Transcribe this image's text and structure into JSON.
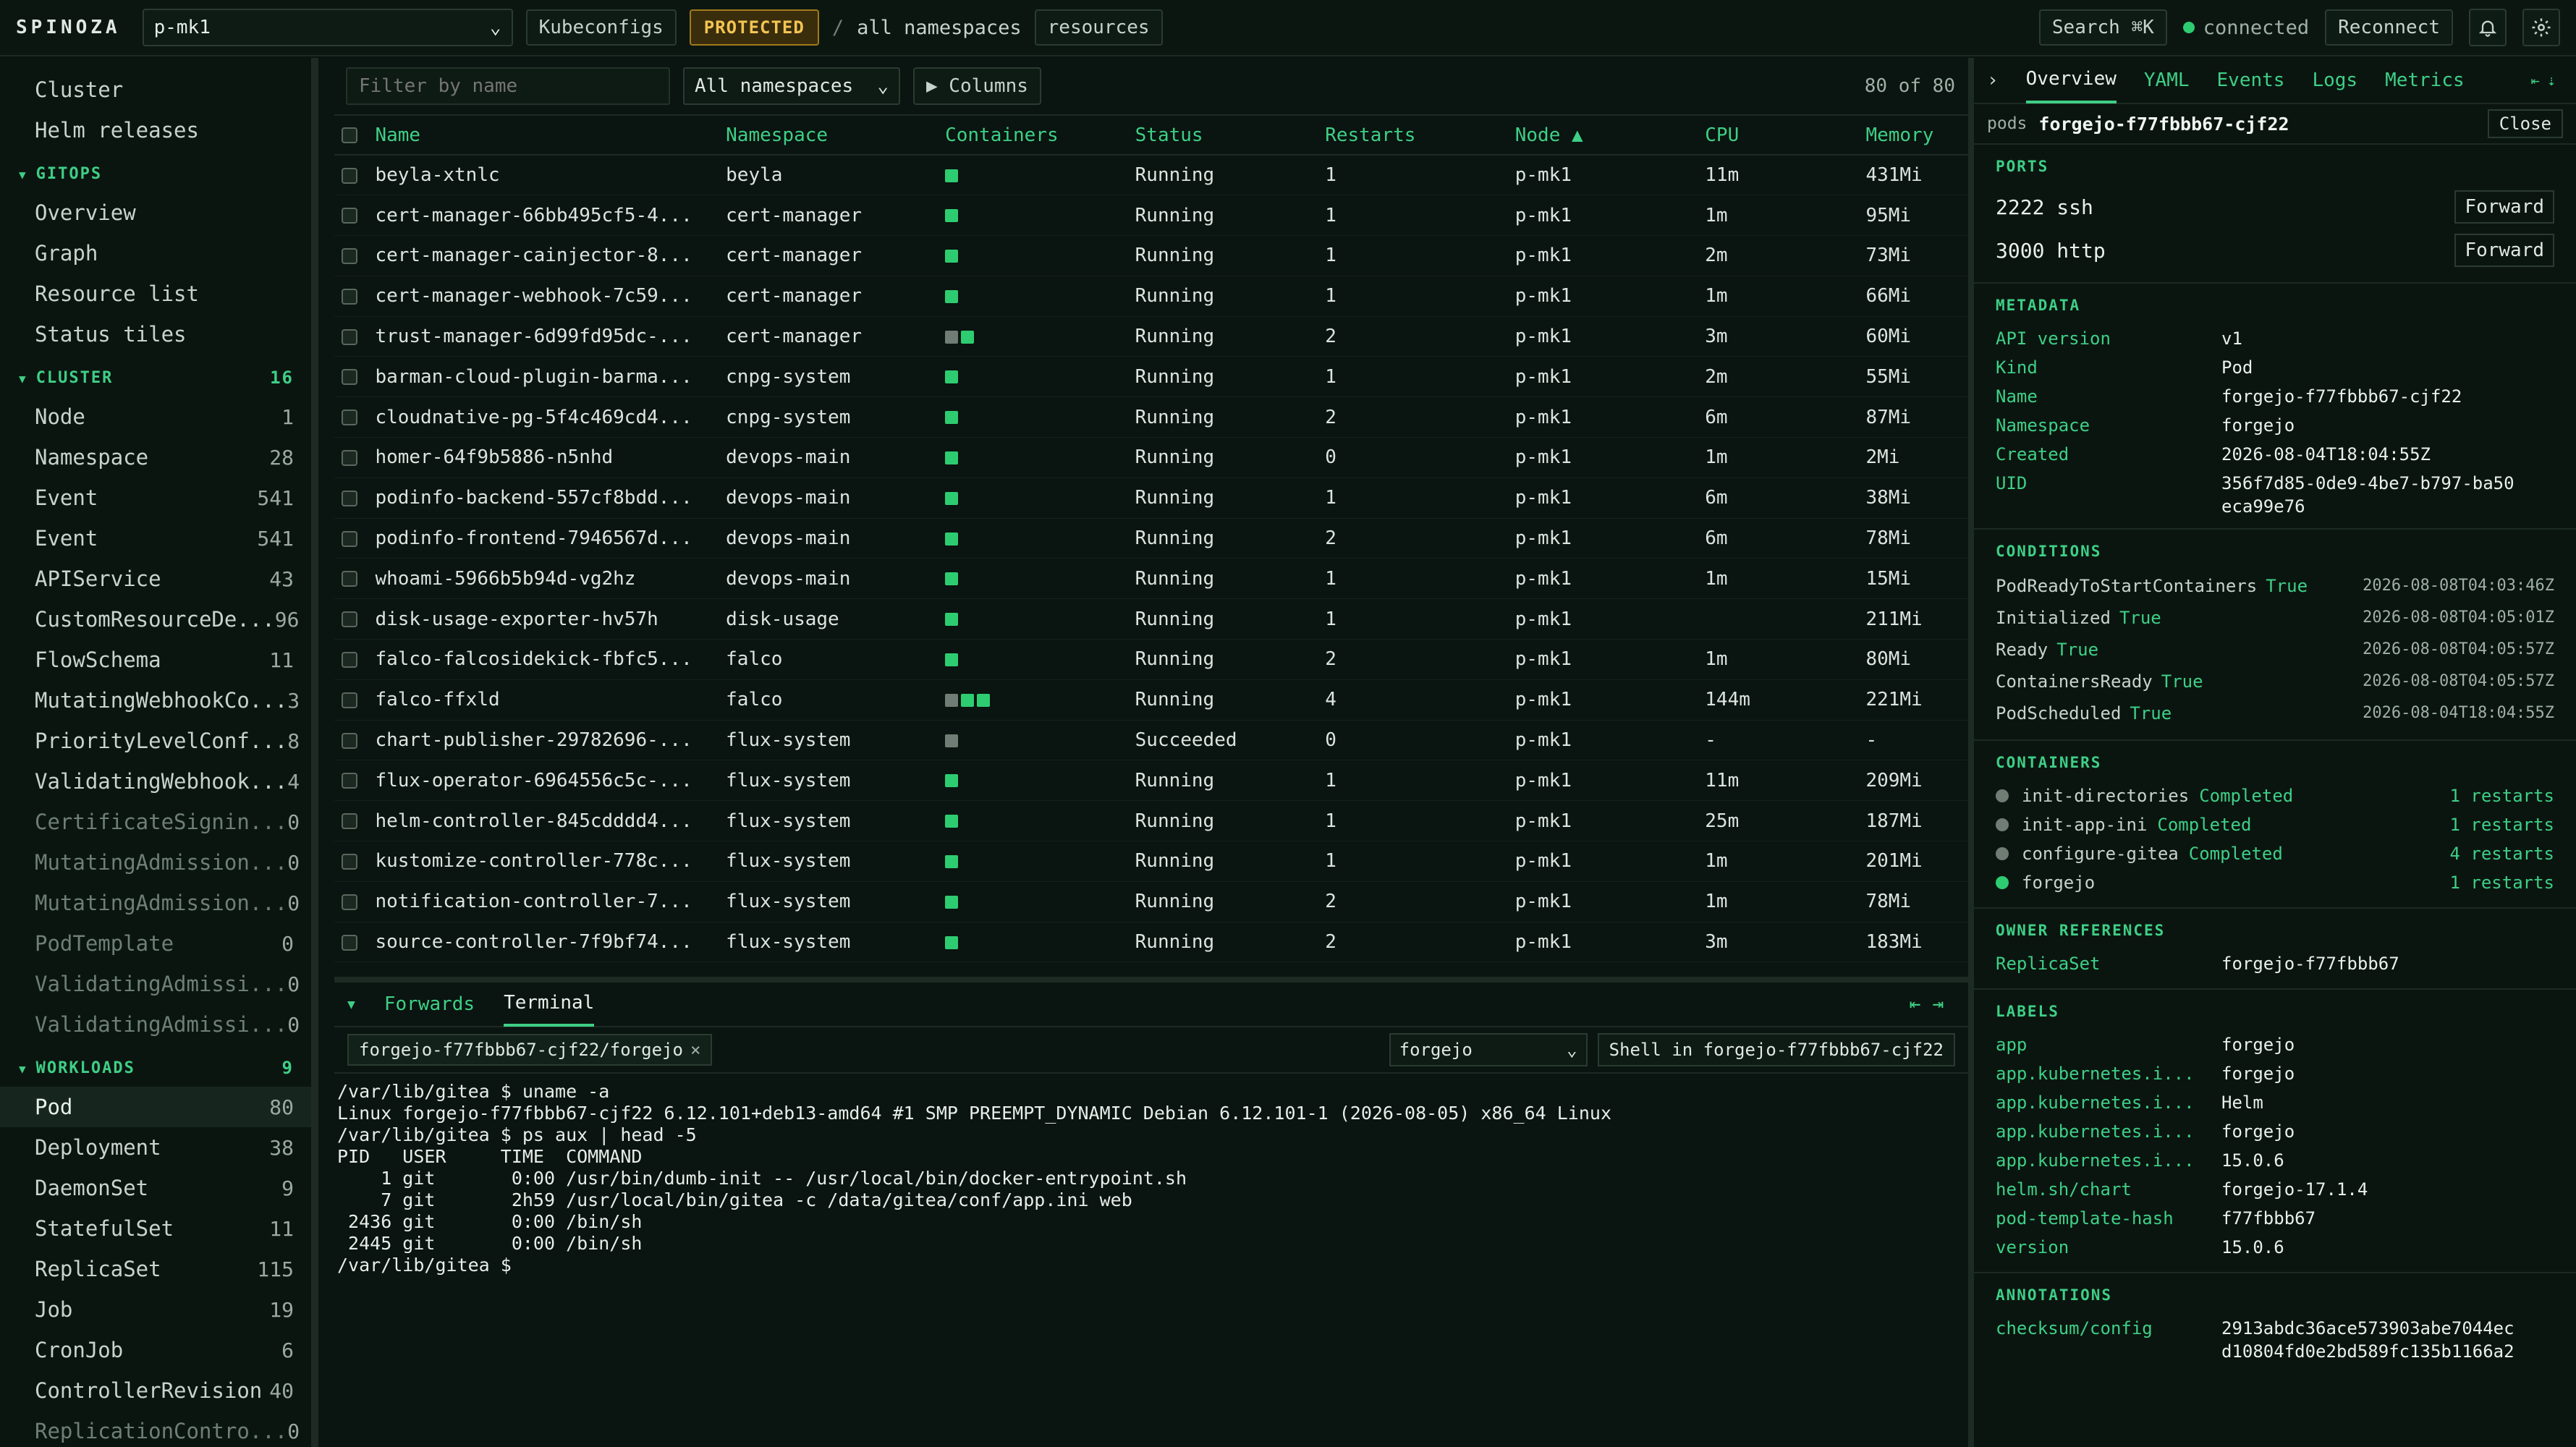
{
  "topbar": {
    "brand": "SPINOZA",
    "context": "p-mk1",
    "kubeconfigs": "Kubeconfigs",
    "protected": "PROTECTED",
    "sep": "/",
    "namespace_crumb": "all namespaces",
    "resources": "resources",
    "search": "Search ⌘K",
    "status": "connected",
    "reconnect": "Reconnect"
  },
  "sidebar": {
    "top_items": [
      {
        "label": "Cluster"
      },
      {
        "label": "Helm releases"
      }
    ],
    "gitops": {
      "title": "GITOPS",
      "items": [
        {
          "label": "Overview"
        },
        {
          "label": "Graph"
        },
        {
          "label": "Resource list"
        },
        {
          "label": "Status tiles"
        }
      ]
    },
    "cluster": {
      "title": "CLUSTER",
      "count": "16",
      "items": [
        {
          "label": "Node",
          "count": "1",
          "dim": false
        },
        {
          "label": "Namespace",
          "count": "28",
          "dim": false
        },
        {
          "label": "Event",
          "count": "541",
          "dim": false
        },
        {
          "label": "Event",
          "count": "541",
          "dim": false
        },
        {
          "label": "APIService",
          "count": "43",
          "dim": false
        },
        {
          "label": "CustomResourceDe...",
          "count": "96",
          "dim": false
        },
        {
          "label": "FlowSchema",
          "count": "11",
          "dim": false
        },
        {
          "label": "MutatingWebhookCo...",
          "count": "3",
          "dim": false
        },
        {
          "label": "PriorityLevelConf...",
          "count": "8",
          "dim": false
        },
        {
          "label": "ValidatingWebhook...",
          "count": "4",
          "dim": false
        },
        {
          "label": "CertificateSignin...",
          "count": "0",
          "dim": true
        },
        {
          "label": "MutatingAdmission...",
          "count": "0",
          "dim": true
        },
        {
          "label": "MutatingAdmission...",
          "count": "0",
          "dim": true
        },
        {
          "label": "PodTemplate",
          "count": "0",
          "dim": true
        },
        {
          "label": "ValidatingAdmissi...",
          "count": "0",
          "dim": true
        },
        {
          "label": "ValidatingAdmissi...",
          "count": "0",
          "dim": true
        }
      ]
    },
    "workloads": {
      "title": "WORKLOADS",
      "count": "9",
      "items": [
        {
          "label": "Pod",
          "count": "80",
          "dim": false,
          "active": true
        },
        {
          "label": "Deployment",
          "count": "38",
          "dim": false
        },
        {
          "label": "DaemonSet",
          "count": "9",
          "dim": false
        },
        {
          "label": "StatefulSet",
          "count": "11",
          "dim": false
        },
        {
          "label": "ReplicaSet",
          "count": "115",
          "dim": false
        },
        {
          "label": "Job",
          "count": "19",
          "dim": false
        },
        {
          "label": "CronJob",
          "count": "6",
          "dim": false
        },
        {
          "label": "ControllerRevision",
          "count": "40",
          "dim": false
        },
        {
          "label": "ReplicationContro...",
          "count": "0",
          "dim": true
        }
      ]
    }
  },
  "main": {
    "filter_placeholder": "Filter by name",
    "namespace_select": "All namespaces",
    "columns_button": "▶ Columns",
    "count": "80 of 80",
    "headers": [
      "Name",
      "Namespace",
      "Containers",
      "Status",
      "Restarts",
      "Node ▲",
      "CPU",
      "Memory"
    ],
    "rows": [
      {
        "name": "beyla-xtnlc",
        "ns": "beyla",
        "c": [
          "g"
        ],
        "status": "Running",
        "restarts": "1",
        "node": "p-mk1",
        "cpu": "11m",
        "mem": "431Mi"
      },
      {
        "name": "cert-manager-66bb495cf5-4...",
        "ns": "cert-manager",
        "c": [
          "g"
        ],
        "status": "Running",
        "restarts": "1",
        "node": "p-mk1",
        "cpu": "1m",
        "mem": "95Mi"
      },
      {
        "name": "cert-manager-cainjector-8...",
        "ns": "cert-manager",
        "c": [
          "g"
        ],
        "status": "Running",
        "restarts": "1",
        "node": "p-mk1",
        "cpu": "2m",
        "mem": "73Mi"
      },
      {
        "name": "cert-manager-webhook-7c59...",
        "ns": "cert-manager",
        "c": [
          "g"
        ],
        "status": "Running",
        "restarts": "1",
        "node": "p-mk1",
        "cpu": "1m",
        "mem": "66Mi"
      },
      {
        "name": "trust-manager-6d99fd95dc-...",
        "ns": "cert-manager",
        "c": [
          "x",
          "g"
        ],
        "status": "Running",
        "restarts": "2",
        "node": "p-mk1",
        "cpu": "3m",
        "mem": "60Mi"
      },
      {
        "name": "barman-cloud-plugin-barma...",
        "ns": "cnpg-system",
        "c": [
          "g"
        ],
        "status": "Running",
        "restarts": "1",
        "node": "p-mk1",
        "cpu": "2m",
        "mem": "55Mi"
      },
      {
        "name": "cloudnative-pg-5f4c469cd4...",
        "ns": "cnpg-system",
        "c": [
          "g"
        ],
        "status": "Running",
        "restarts": "2",
        "node": "p-mk1",
        "cpu": "6m",
        "mem": "87Mi"
      },
      {
        "name": "homer-64f9b5886-n5nhd",
        "ns": "devops-main",
        "c": [
          "g"
        ],
        "status": "Running",
        "restarts": "0",
        "node": "p-mk1",
        "cpu": "1m",
        "mem": "2Mi"
      },
      {
        "name": "podinfo-backend-557cf8bdd...",
        "ns": "devops-main",
        "c": [
          "g"
        ],
        "status": "Running",
        "restarts": "1",
        "node": "p-mk1",
        "cpu": "6m",
        "mem": "38Mi"
      },
      {
        "name": "podinfo-frontend-7946567d...",
        "ns": "devops-main",
        "c": [
          "g"
        ],
        "status": "Running",
        "restarts": "2",
        "node": "p-mk1",
        "cpu": "6m",
        "mem": "78Mi"
      },
      {
        "name": "whoami-5966b5b94d-vg2hz",
        "ns": "devops-main",
        "c": [
          "g"
        ],
        "status": "Running",
        "restarts": "1",
        "node": "p-mk1",
        "cpu": "1m",
        "mem": "15Mi"
      },
      {
        "name": "disk-usage-exporter-hv57h",
        "ns": "disk-usage",
        "c": [
          "g"
        ],
        "status": "Running",
        "restarts": "1",
        "node": "p-mk1",
        "cpu": "",
        "mem": "211Mi"
      },
      {
        "name": "falco-falcosidekick-fbfc5...",
        "ns": "falco",
        "c": [
          "g"
        ],
        "status": "Running",
        "restarts": "2",
        "node": "p-mk1",
        "cpu": "1m",
        "mem": "80Mi"
      },
      {
        "name": "falco-ffxld",
        "ns": "falco",
        "c": [
          "x",
          "g",
          "g"
        ],
        "status": "Running",
        "restarts": "4",
        "node": "p-mk1",
        "cpu": "144m",
        "mem": "221Mi"
      },
      {
        "name": "chart-publisher-29782696-...",
        "ns": "flux-system",
        "c": [
          "x"
        ],
        "status": "Succeeded",
        "restarts": "0",
        "node": "p-mk1",
        "cpu": "-",
        "mem": "-"
      },
      {
        "name": "flux-operator-6964556c5c-...",
        "ns": "flux-system",
        "c": [
          "g"
        ],
        "status": "Running",
        "restarts": "1",
        "node": "p-mk1",
        "cpu": "11m",
        "mem": "209Mi"
      },
      {
        "name": "helm-controller-845cdddd4...",
        "ns": "flux-system",
        "c": [
          "g"
        ],
        "status": "Running",
        "restarts": "1",
        "node": "p-mk1",
        "cpu": "25m",
        "mem": "187Mi"
      },
      {
        "name": "kustomize-controller-778c...",
        "ns": "flux-system",
        "c": [
          "g"
        ],
        "status": "Running",
        "restarts": "1",
        "node": "p-mk1",
        "cpu": "1m",
        "mem": "201Mi"
      },
      {
        "name": "notification-controller-7...",
        "ns": "flux-system",
        "c": [
          "g"
        ],
        "status": "Running",
        "restarts": "2",
        "node": "p-mk1",
        "cpu": "1m",
        "mem": "78Mi"
      },
      {
        "name": "source-controller-7f9bf74...",
        "ns": "flux-system",
        "c": [
          "g"
        ],
        "status": "Running",
        "restarts": "2",
        "node": "p-mk1",
        "cpu": "3m",
        "mem": "183Mi"
      }
    ]
  },
  "bottom": {
    "tabs": [
      "Forwards",
      "Terminal"
    ],
    "active_tab": "Terminal",
    "terminal_tab": "forgejo-f77fbbb67-cjf22/forgejo",
    "container_select": "forgejo",
    "shell_button": "Shell in forgejo-f77fbbb67-cjf22",
    "terminal_lines": [
      "/var/lib/gitea $ uname -a",
      "Linux forgejo-f77fbbb67-cjf22 6.12.101+deb13-amd64 #1 SMP PREEMPT_DYNAMIC Debian 6.12.101-1 (2026-08-05) x86_64 Linux",
      "/var/lib/gitea $ ps aux | head -5",
      "PID   USER     TIME  COMMAND",
      "    1 git       0:00 /usr/bin/dumb-init -- /usr/local/bin/docker-entrypoint.sh",
      "    7 git       2h59 /usr/local/bin/gitea -c /data/gitea/conf/app.ini web",
      " 2436 git       0:00 /bin/sh",
      " 2445 git       0:00 /bin/sh",
      "/var/lib/gitea $"
    ]
  },
  "detail": {
    "tabs": [
      "Overview",
      "YAML",
      "Events",
      "Logs",
      "Metrics"
    ],
    "active_tab": "Overview",
    "kind": "pods",
    "name": "forgejo-f77fbbb67-cjf22",
    "close": "Close",
    "ports_title": "PORTS",
    "ports": [
      {
        "label": "2222 ssh",
        "button": "Forward"
      },
      {
        "label": "3000 http",
        "button": "Forward"
      }
    ],
    "metadata_title": "METADATA",
    "metadata": [
      {
        "k": "API version",
        "v": "v1"
      },
      {
        "k": "Kind",
        "v": "Pod"
      },
      {
        "k": "Name",
        "v": "forgejo-f77fbbb67-cjf22"
      },
      {
        "k": "Namespace",
        "v": "forgejo"
      },
      {
        "k": "Created",
        "v": "2026-08-04T18:04:55Z"
      },
      {
        "k": "UID",
        "v": "356f7d85-0de9-4be7-b797-ba50\neca99e76"
      }
    ],
    "conditions_title": "CONDITIONS",
    "conditions": [
      {
        "type": "PodReadyToStartContainers",
        "status": "True",
        "time": "2026-08-08T04:03:46Z"
      },
      {
        "type": "Initialized",
        "status": "True",
        "time": "2026-08-08T04:05:01Z"
      },
      {
        "type": "Ready",
        "status": "True",
        "time": "2026-08-08T04:05:57Z"
      },
      {
        "type": "ContainersReady",
        "status": "True",
        "time": "2026-08-08T04:05:57Z"
      },
      {
        "type": "PodScheduled",
        "status": "True",
        "time": "2026-08-04T18:04:55Z"
      }
    ],
    "containers_title": "CONTAINERS",
    "containers": [
      {
        "name": "init-directories",
        "state": "Completed",
        "restarts": "1 restarts",
        "live": false
      },
      {
        "name": "init-app-ini",
        "state": "Completed",
        "restarts": "1 restarts",
        "live": false
      },
      {
        "name": "configure-gitea",
        "state": "Completed",
        "restarts": "4 restarts",
        "live": false
      },
      {
        "name": "forgejo",
        "state": "",
        "restarts": "1 restarts",
        "live": true
      }
    ],
    "owner_title": "OWNER REFERENCES",
    "owners": [
      {
        "k": "ReplicaSet",
        "v": "forgejo-f77fbbb67"
      }
    ],
    "labels_title": "LABELS",
    "labels": [
      {
        "k": "app",
        "v": "forgejo"
      },
      {
        "k": "app.kubernetes.i...",
        "v": "forgejo"
      },
      {
        "k": "app.kubernetes.i...",
        "v": "Helm"
      },
      {
        "k": "app.kubernetes.i...",
        "v": "forgejo"
      },
      {
        "k": "app.kubernetes.i...",
        "v": "15.0.6"
      },
      {
        "k": "helm.sh/chart",
        "v": "forgejo-17.1.4"
      },
      {
        "k": "pod-template-hash",
        "v": "f77fbbb67"
      },
      {
        "k": "version",
        "v": "15.0.6"
      }
    ],
    "annotations_title": "ANNOTATIONS",
    "annotations": [
      {
        "k": "checksum/config",
        "v": "2913abdc36ace573903abe7044ec\nd10804fd0e2bd589fc135b1166a2"
      }
    ]
  }
}
